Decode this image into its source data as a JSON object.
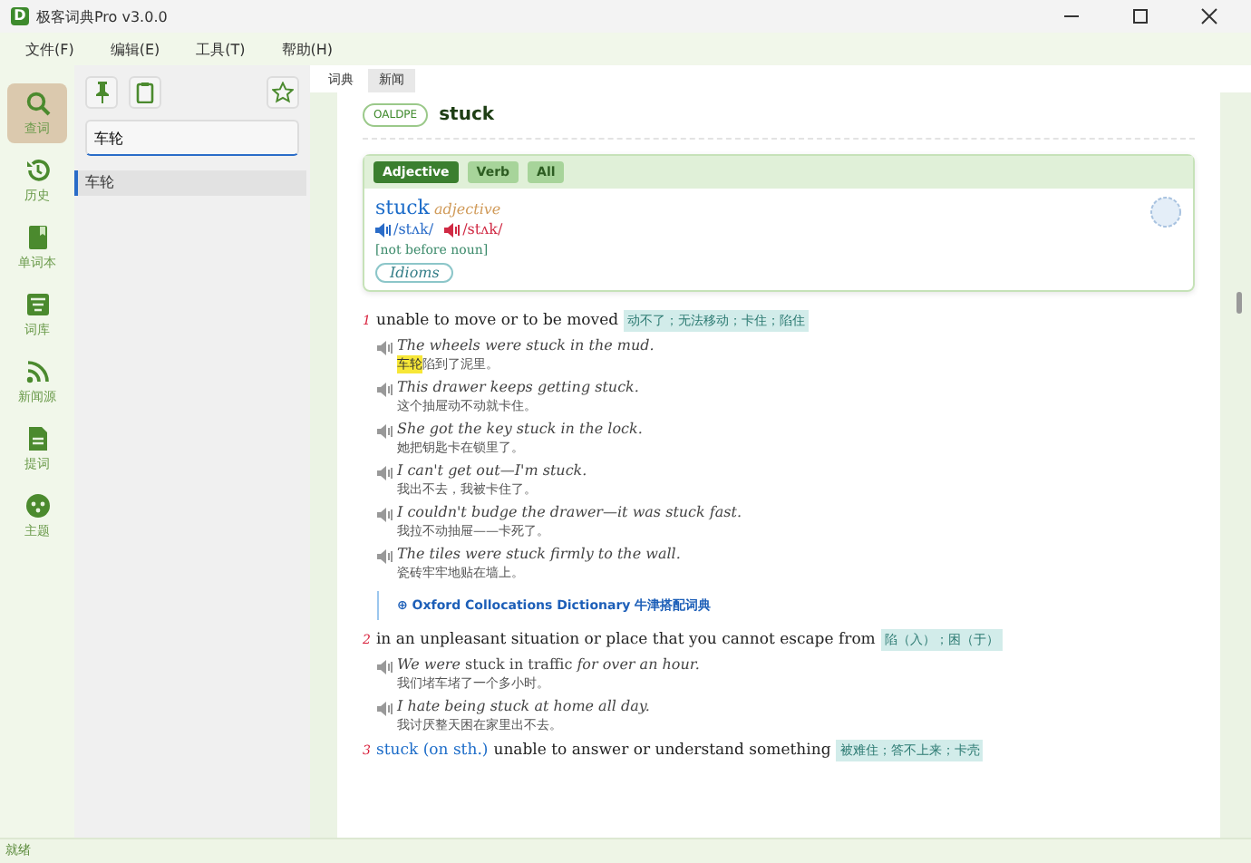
{
  "window": {
    "title": "极客词典Pro v3.0.0",
    "icon_letter": "D"
  },
  "menu": [
    {
      "label": "文件(F)"
    },
    {
      "label": "编辑(E)"
    },
    {
      "label": "工具(T)"
    },
    {
      "label": "帮助(H)"
    }
  ],
  "nav": [
    {
      "label": "查词",
      "selected": true
    },
    {
      "label": "历史",
      "selected": false
    },
    {
      "label": "单词本",
      "selected": false
    },
    {
      "label": "词库",
      "selected": false
    },
    {
      "label": "新闻源",
      "selected": false
    },
    {
      "label": "提词",
      "selected": false
    },
    {
      "label": "主题",
      "selected": false
    }
  ],
  "panel": {
    "search": {
      "value": "车轮"
    },
    "results": [
      {
        "label": "车轮",
        "selected": true
      }
    ]
  },
  "tabs": [
    {
      "label": "词典",
      "selected": true
    },
    {
      "label": "新闻",
      "selected": false
    }
  ],
  "entry": {
    "source": "OALDPE",
    "headword": "stuck",
    "pos_tabs": [
      {
        "label": "Adjective",
        "selected": true
      },
      {
        "label": "Verb",
        "selected": false
      },
      {
        "label": "All",
        "selected": false
      }
    ],
    "word": "stuck",
    "pos": "adjective",
    "pronunciations": [
      {
        "kind": "br",
        "text": "/stʌk/"
      },
      {
        "kind": "us",
        "text": "/stʌk/"
      }
    ],
    "grammar": "[not before noun]",
    "idioms": "Idioms"
  },
  "senses": [
    {
      "number": "1",
      "definition": "unable to move or to be moved",
      "translation": "动不了；无法移动；卡住；陷住",
      "examples": [
        {
          "en": "The wheels were stuck in the mud.",
          "italic": true,
          "zh_highlight": "车轮",
          "zh": "陷到了泥里。"
        },
        {
          "en": "This drawer keeps getting stuck.",
          "italic": true,
          "zh": "这个抽屉动不动就卡住。"
        },
        {
          "en": "She got the key stuck in the lock.",
          "italic": true,
          "zh": "她把钥匙卡在锁里了。"
        },
        {
          "en": "I can't get out—I'm stuck.",
          "italic": true,
          "zh": "我出不去，我被卡住了。"
        },
        {
          "en": "I couldn't budge the drawer—it was stuck fast.",
          "italic": true,
          "zh": "我拉不动抽屉——卡死了。"
        },
        {
          "en": "The tiles were stuck firmly to the wall.",
          "italic": true,
          "zh": "瓷砖牢牢地贴在墙上。"
        }
      ],
      "collocations": "⊕ Oxford Collocations Dictionary 牛津搭配词典"
    },
    {
      "number": "2",
      "definition": "in an unpleasant situation or place that you cannot escape from",
      "translation": "陷（入）；困（于）",
      "examples": [
        {
          "en": "*We were* stuck in traffic *for over an hour.*",
          "italic": false,
          "zh": "我们堵车堵了一个多小时。"
        },
        {
          "en": "I hate being stuck at home all day.",
          "italic": true,
          "zh": "我讨厌整天困在家里出不去。"
        }
      ]
    },
    {
      "number": "3",
      "phrase": "stuck (on sth.)",
      "definition": "unable to answer or understand something",
      "translation": "被难住；答不上来；卡壳"
    }
  ],
  "status_bar": "就绪"
}
